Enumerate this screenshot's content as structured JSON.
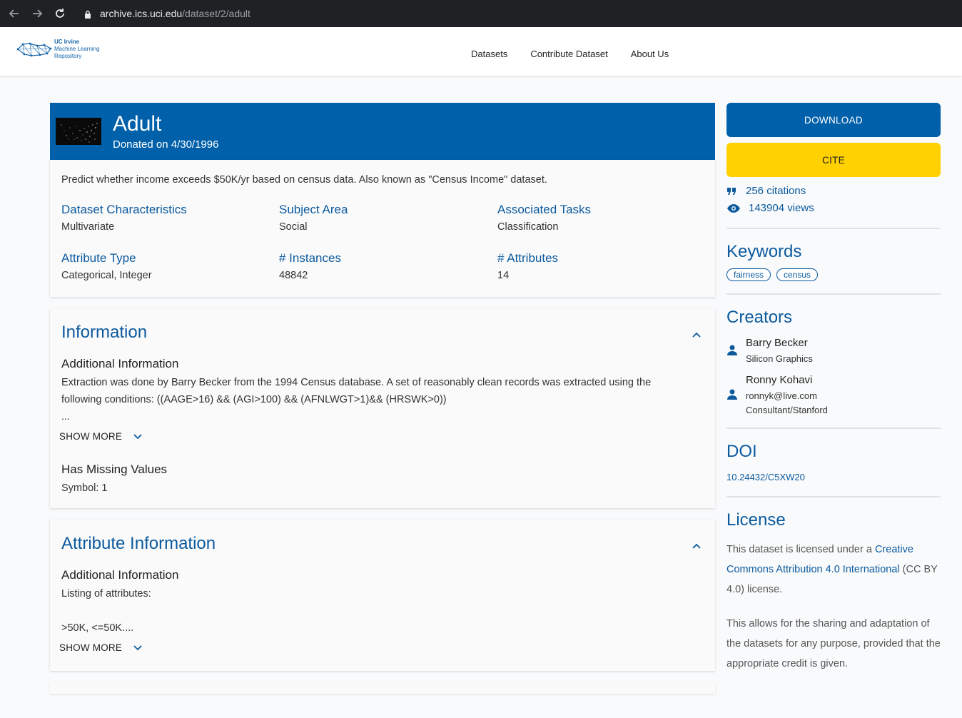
{
  "browser": {
    "url_host": "archive.ics.uci.edu",
    "url_path": "/dataset/2/adult"
  },
  "header": {
    "logo_line1": "UC Irvine",
    "logo_line2": "Machine Learning",
    "logo_line3": "Repository",
    "nav": [
      "Datasets",
      "Contribute Dataset",
      "About Us"
    ]
  },
  "dataset": {
    "title": "Adult",
    "donated": "Donated on 4/30/1996",
    "description": "Predict whether income exceeds $50K/yr based on census data. Also known as \"Census Income\" dataset.",
    "facts": [
      {
        "label": "Dataset Characteristics",
        "value": "Multivariate"
      },
      {
        "label": "Subject Area",
        "value": "Social"
      },
      {
        "label": "Associated Tasks",
        "value": "Classification"
      },
      {
        "label": "Attribute Type",
        "value": "Categorical, Integer"
      },
      {
        "label": "# Instances",
        "value": "48842"
      },
      {
        "label": "# Attributes",
        "value": "14"
      }
    ]
  },
  "information": {
    "title": "Information",
    "add_info_heading": "Additional Information",
    "add_info_line1": "Extraction was done by Barry Becker from the 1994 Census database.  A set of reasonably clean records was extracted using the",
    "add_info_line2": "following conditions: ((AAGE>16) && (AGI>100) && (AFNLWGT>1)&& (HRSWK>0))",
    "ellipsis": "...",
    "show_more": "SHOW MORE",
    "missing_heading": "Has Missing Values",
    "missing_value": "Symbol: 1"
  },
  "attribute_info": {
    "title": "Attribute Information",
    "add_info_heading": "Additional Information",
    "line1": "Listing of attributes:",
    "line2": ">50K, <=50K....",
    "show_more": "SHOW MORE"
  },
  "sidebar": {
    "download": "DOWNLOAD",
    "cite": "CITE",
    "citations": "256 citations",
    "views": "143904 views",
    "keywords_heading": "Keywords",
    "keywords": [
      "fairness",
      "census"
    ],
    "creators_heading": "Creators",
    "creators": [
      {
        "name": "Barry Becker",
        "line1": "Silicon Graphics",
        "line2": ""
      },
      {
        "name": "Ronny Kohavi",
        "line1": "ronnyk@live.com",
        "line2": "Consultant/Stanford"
      }
    ],
    "doi_heading": "DOI",
    "doi": "10.24432/C5XW20",
    "license_heading": "License",
    "license_pre": "This dataset is licensed under a ",
    "license_link": "Creative Commons Attribution 4.0 International",
    "license_post": " (CC BY 4.0) license.",
    "license_note": "This allows for the sharing and adaptation of the datasets for any purpose, provided that the appropriate credit is given."
  },
  "colors": {
    "brand_blue": "#0060a9",
    "cite_yellow": "#ffd100",
    "heading_blue": "#0b5a9e"
  }
}
